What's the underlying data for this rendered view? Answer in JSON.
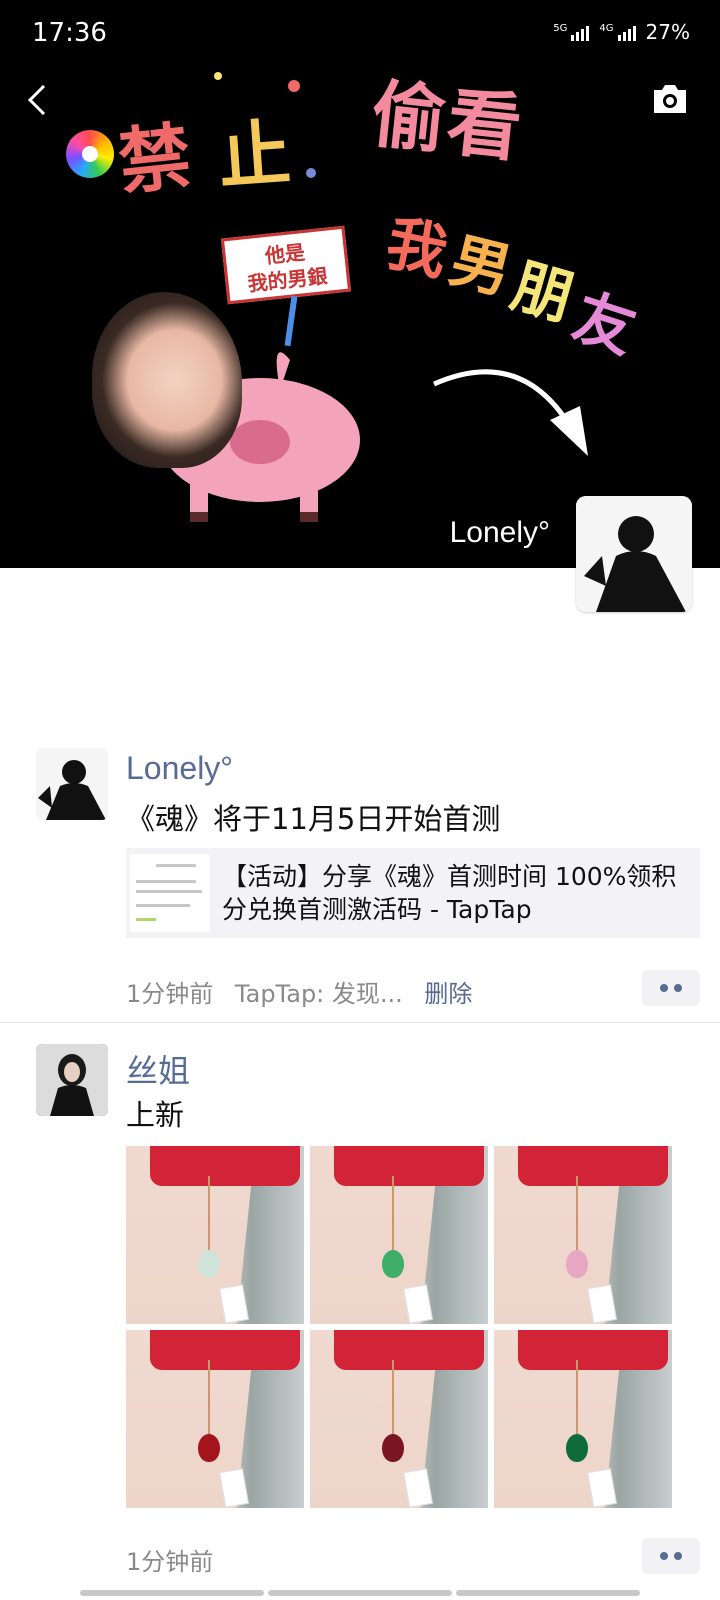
{
  "status_bar": {
    "time": "17:36",
    "network_1": "5G",
    "network_2": "4G",
    "battery": "27%"
  },
  "cover": {
    "text_line1_a": "禁",
    "text_line1_b": "止",
    "text_line2": "偷看",
    "text_line3_a": "我",
    "text_line3_b": "男",
    "text_line3_c": "朋",
    "text_line3_d": "友",
    "sign_line1": "他是",
    "sign_line2": "我的男銀",
    "owner_name": "Lonely°"
  },
  "posts": [
    {
      "user": "Lonely°",
      "text": "《魂》将于11月5日开始首测",
      "link_title": "【活动】分享《魂》首测时间 100%领积分兑换首测激活码 - TapTap",
      "time": "1分钟前",
      "source": "TapTap: 发现...",
      "delete_label": "删除"
    },
    {
      "user": "丝姐",
      "text": "上新",
      "time": "1分钟前",
      "photos": [
        {
          "pendant_color": "#cfe3da"
        },
        {
          "pendant_color": "#3fae68"
        },
        {
          "pendant_color": "#e7a7c2"
        },
        {
          "pendant_color": "#a4141c"
        },
        {
          "pendant_color": "#7a1622"
        },
        {
          "pendant_color": "#0f6b3b"
        }
      ]
    }
  ],
  "colors": {
    "link_blue": "#576b95",
    "meta_gray": "#8a8a8a"
  },
  "icons": {
    "back": "chevron-left-icon",
    "camera": "camera-icon",
    "more": "more-dots-icon"
  }
}
